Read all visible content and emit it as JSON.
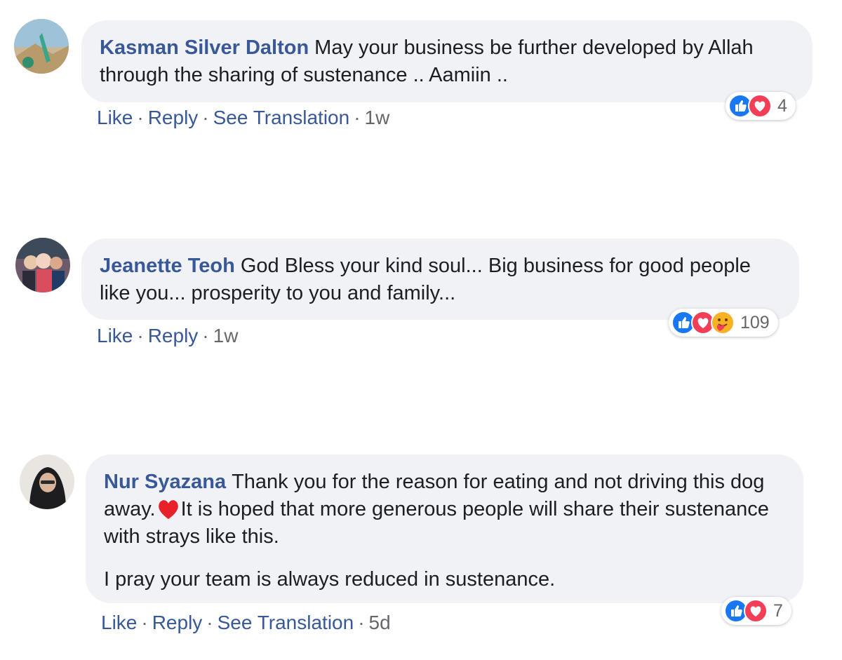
{
  "comments": [
    {
      "author": "Kasman Silver Dalton",
      "paragraphs": [
        "May your business be further developed by Allah through the sharing of sustenance .. Aamiin .."
      ],
      "actions": {
        "like": "Like",
        "reply": "Reply",
        "translate": "See Translation",
        "time": "1w"
      },
      "reactions": {
        "types": [
          "like-icon",
          "love-icon"
        ],
        "count": "4"
      }
    },
    {
      "author": "Jeanette Teoh",
      "paragraphs": [
        "God Bless your kind soul... Big business for good people like you... prosperity to you and family..."
      ],
      "actions": {
        "like": "Like",
        "reply": "Reply",
        "time": "1w"
      },
      "reactions": {
        "types": [
          "like-icon",
          "love-icon",
          "care-icon"
        ],
        "count": "109"
      }
    },
    {
      "author": "Nur Syazana",
      "paragraphs": [
        {
          "before": "Thank you for the reason for eating and not driving this dog away.",
          "emoji": "red-heart-icon",
          "after": "It is hoped that more generous people will share their sustenance with strays like this."
        },
        "I pray your team is always reduced in sustenance."
      ],
      "actions": {
        "like": "Like",
        "reply": "Reply",
        "translate": "See Translation",
        "time": "5d"
      },
      "reactions": {
        "types": [
          "like-icon",
          "love-icon"
        ],
        "count": "7"
      }
    }
  ],
  "separator": "·",
  "colors": {
    "author": "#385898",
    "bubble": "#f0f2f5",
    "meta": "#65676b",
    "like_blue": "#1877f2",
    "love_red": "#f33e58"
  }
}
